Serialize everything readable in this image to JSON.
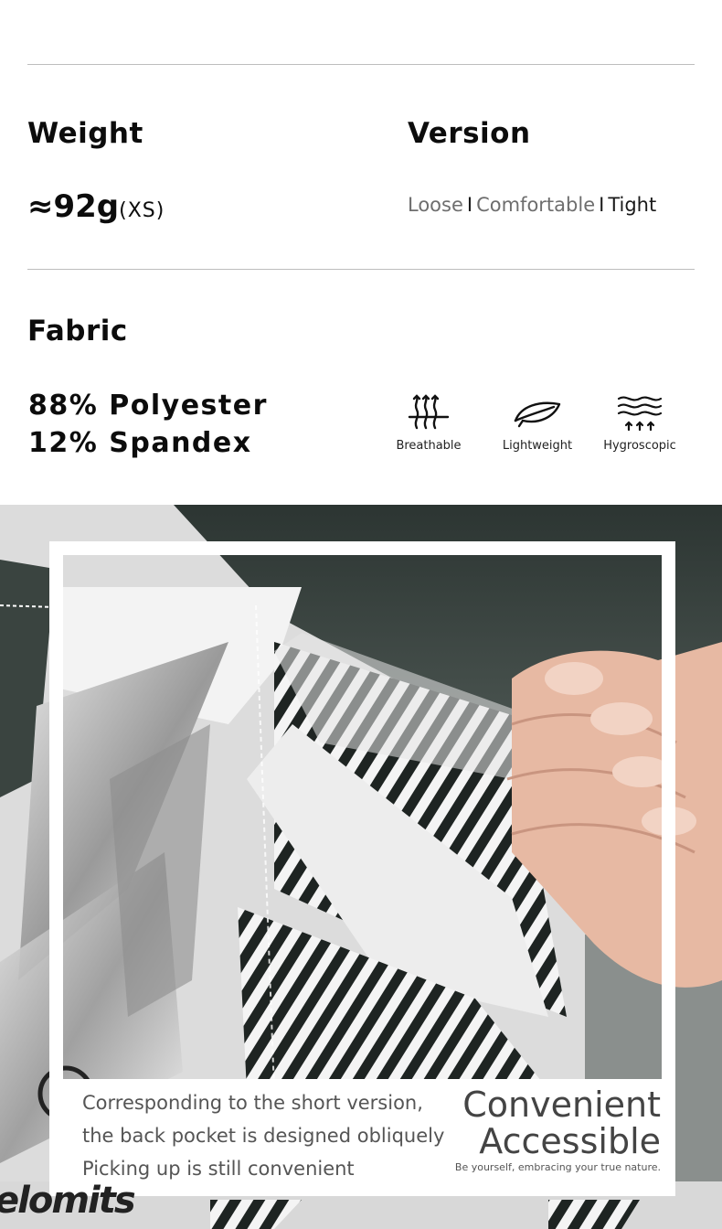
{
  "specs": {
    "weight": {
      "label": "Weight",
      "value": "≈92g",
      "unit": "(XS)"
    },
    "version": {
      "label": "Version",
      "options": [
        "Loose",
        "Comfortable",
        "Tight"
      ],
      "separator": "I"
    },
    "fabric": {
      "label": "Fabric",
      "composition": [
        "88% Polyester",
        "12% Spandex"
      ]
    }
  },
  "features": [
    {
      "label": "Breathable",
      "icon": "breathable-icon"
    },
    {
      "label": "Lightweight",
      "icon": "leaf-icon"
    },
    {
      "label": "Hygroscopic",
      "icon": "moisture-wave-icon"
    }
  ],
  "product_image": {
    "caption_lines": [
      "Corresponding to the short version,",
      "the back pocket is designed obliquely",
      "Picking up is still convenient"
    ],
    "headline": [
      "Convenient",
      "Accessible"
    ],
    "tagline": "Be yourself, embracing your true nature.",
    "brand_partial": "elomits"
  },
  "colors": {
    "text_primary": "#0c0c0c",
    "text_muted": "#6e6e6e",
    "divider": "#bdbdbd",
    "fabric_dark": "#2f3a36",
    "fabric_light": "#f2f2f2"
  }
}
